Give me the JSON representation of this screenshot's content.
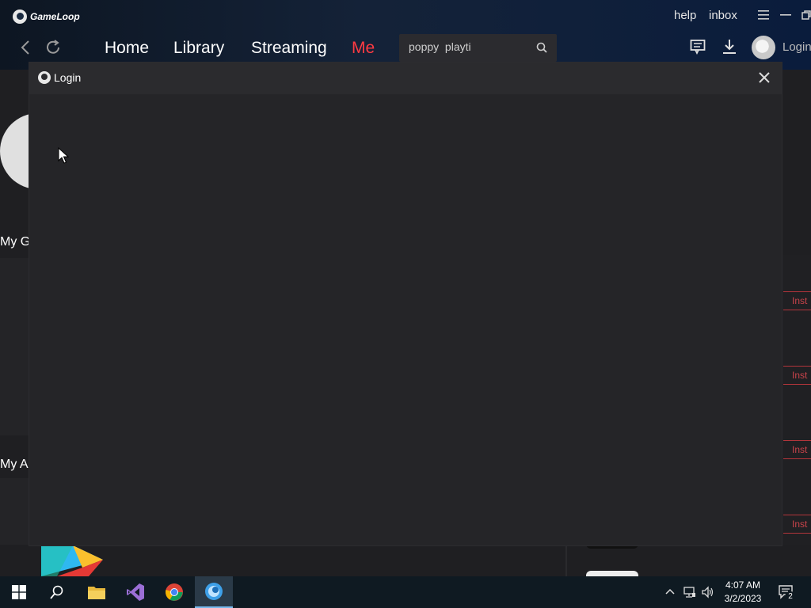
{
  "app": {
    "brand": "GameLoop",
    "top_links": {
      "help": "help",
      "inbox": "inbox"
    }
  },
  "nav": {
    "tabs": [
      {
        "label": "Home"
      },
      {
        "label": "Library"
      },
      {
        "label": "Streaming"
      },
      {
        "label": "Me",
        "active": true
      }
    ],
    "active_color": "#ff3b42"
  },
  "search": {
    "value": "poppy  playti"
  },
  "account": {
    "login_label": "Login"
  },
  "background": {
    "section_my_games": "My G",
    "section_my_apps": "My A",
    "install_label": "Inst"
  },
  "modal": {
    "title": "Login"
  },
  "taskbar": {
    "time": "4:07 AM",
    "date": "3/2/2023",
    "notification_count": "2"
  },
  "icons": [
    "back-icon",
    "refresh-icon",
    "search-icon",
    "chat-icon",
    "download-icon",
    "menu-icon",
    "minimize-icon",
    "restore-icon",
    "close-icon",
    "windows-start-icon",
    "taskbar-search-icon",
    "file-explorer-icon",
    "visual-studio-icon",
    "chrome-icon",
    "gameloop-icon",
    "tray-chevron-icon",
    "network-icon",
    "volume-icon",
    "notification-icon"
  ]
}
